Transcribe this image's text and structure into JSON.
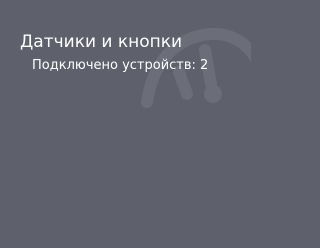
{
  "tile": {
    "title": "Датчики и кнопки",
    "subtitle": "Подключено устройств: 2",
    "icon": "gauge-icon",
    "background_color": "#5e606c",
    "icon_color": "#6b6d78"
  }
}
